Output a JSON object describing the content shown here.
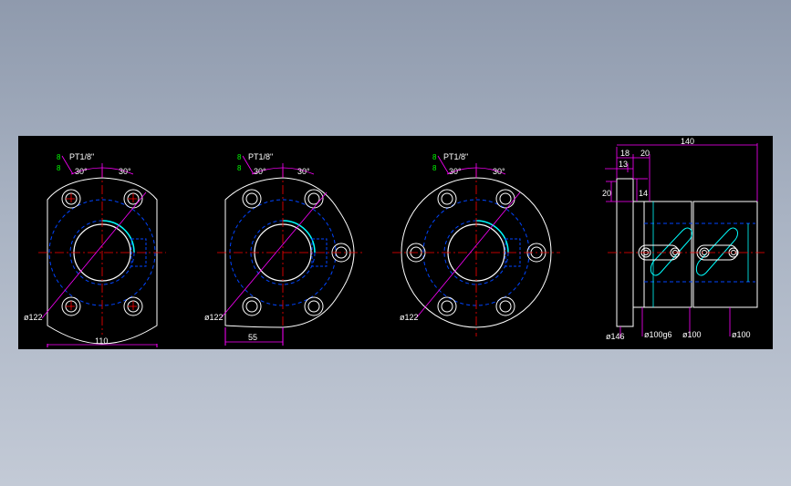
{
  "drawing": {
    "views": [
      {
        "name": "view-1",
        "port_label": "PT1/8\"",
        "angle_left": "30°",
        "angle_right": "30°",
        "pcd_label": "ø122",
        "width_label": "110"
      },
      {
        "name": "view-2",
        "port_label": "PT1/8\"",
        "angle_left": "30°",
        "angle_right": "30°",
        "pcd_label": "ø122",
        "width_label": "55"
      },
      {
        "name": "view-3",
        "port_label": "PT1/8\"",
        "angle_left": "30°",
        "angle_right": "30°",
        "pcd_label": "ø122"
      }
    ],
    "side_view": {
      "overall_length": "140",
      "dim_18": "18",
      "dim_20_top": "20",
      "dim_13": "13",
      "dim_20_left": "20",
      "dim_14": "14",
      "flange_dia": "ø146",
      "dia_g6": "ø100g6",
      "dia_tol_1": "ø100",
      "dia_tol_2": "ø100"
    },
    "small_labels": {
      "a": "8",
      "b": "8"
    },
    "colors": {
      "background": "#000000",
      "outline": "#ffffff",
      "center": "#ff0000",
      "hidden": "#0000ff",
      "dimension": "#ff00ff",
      "text": "#ffffff",
      "accent": "#00ffff",
      "label": "#00ff00"
    }
  }
}
